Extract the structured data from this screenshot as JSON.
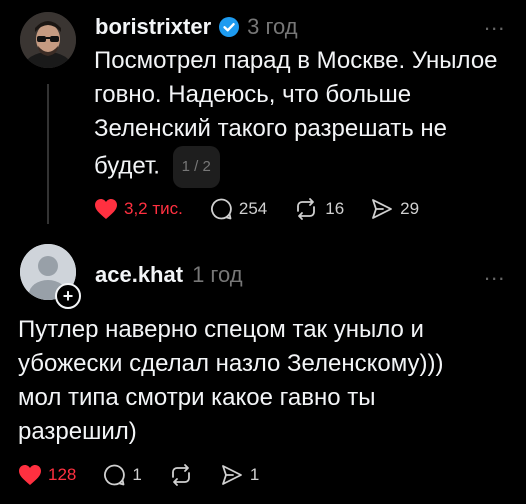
{
  "post": {
    "username": "boristrixter",
    "time": "3 год",
    "more": "...",
    "text": "Посмотрел парад в Москве. Унылое говно. Надеюсь, что больше Зеленский такого разрешать не будет.",
    "pager": "1 / 2",
    "likes": "3,2 тис.",
    "comments": "254",
    "reposts": "16",
    "shares": "29",
    "colors": {
      "like": "#ff3040",
      "verified": "#1d9bf0"
    }
  },
  "reply": {
    "username": "ace.khat",
    "time": "1 год",
    "more": "...",
    "text": "Путлер наверно спецом так уныло и убожески сделал назло Зеленскому))) мол типа смотри какое гавно ты разрешил)",
    "likes": "128",
    "comments": "1",
    "shares": "1"
  }
}
